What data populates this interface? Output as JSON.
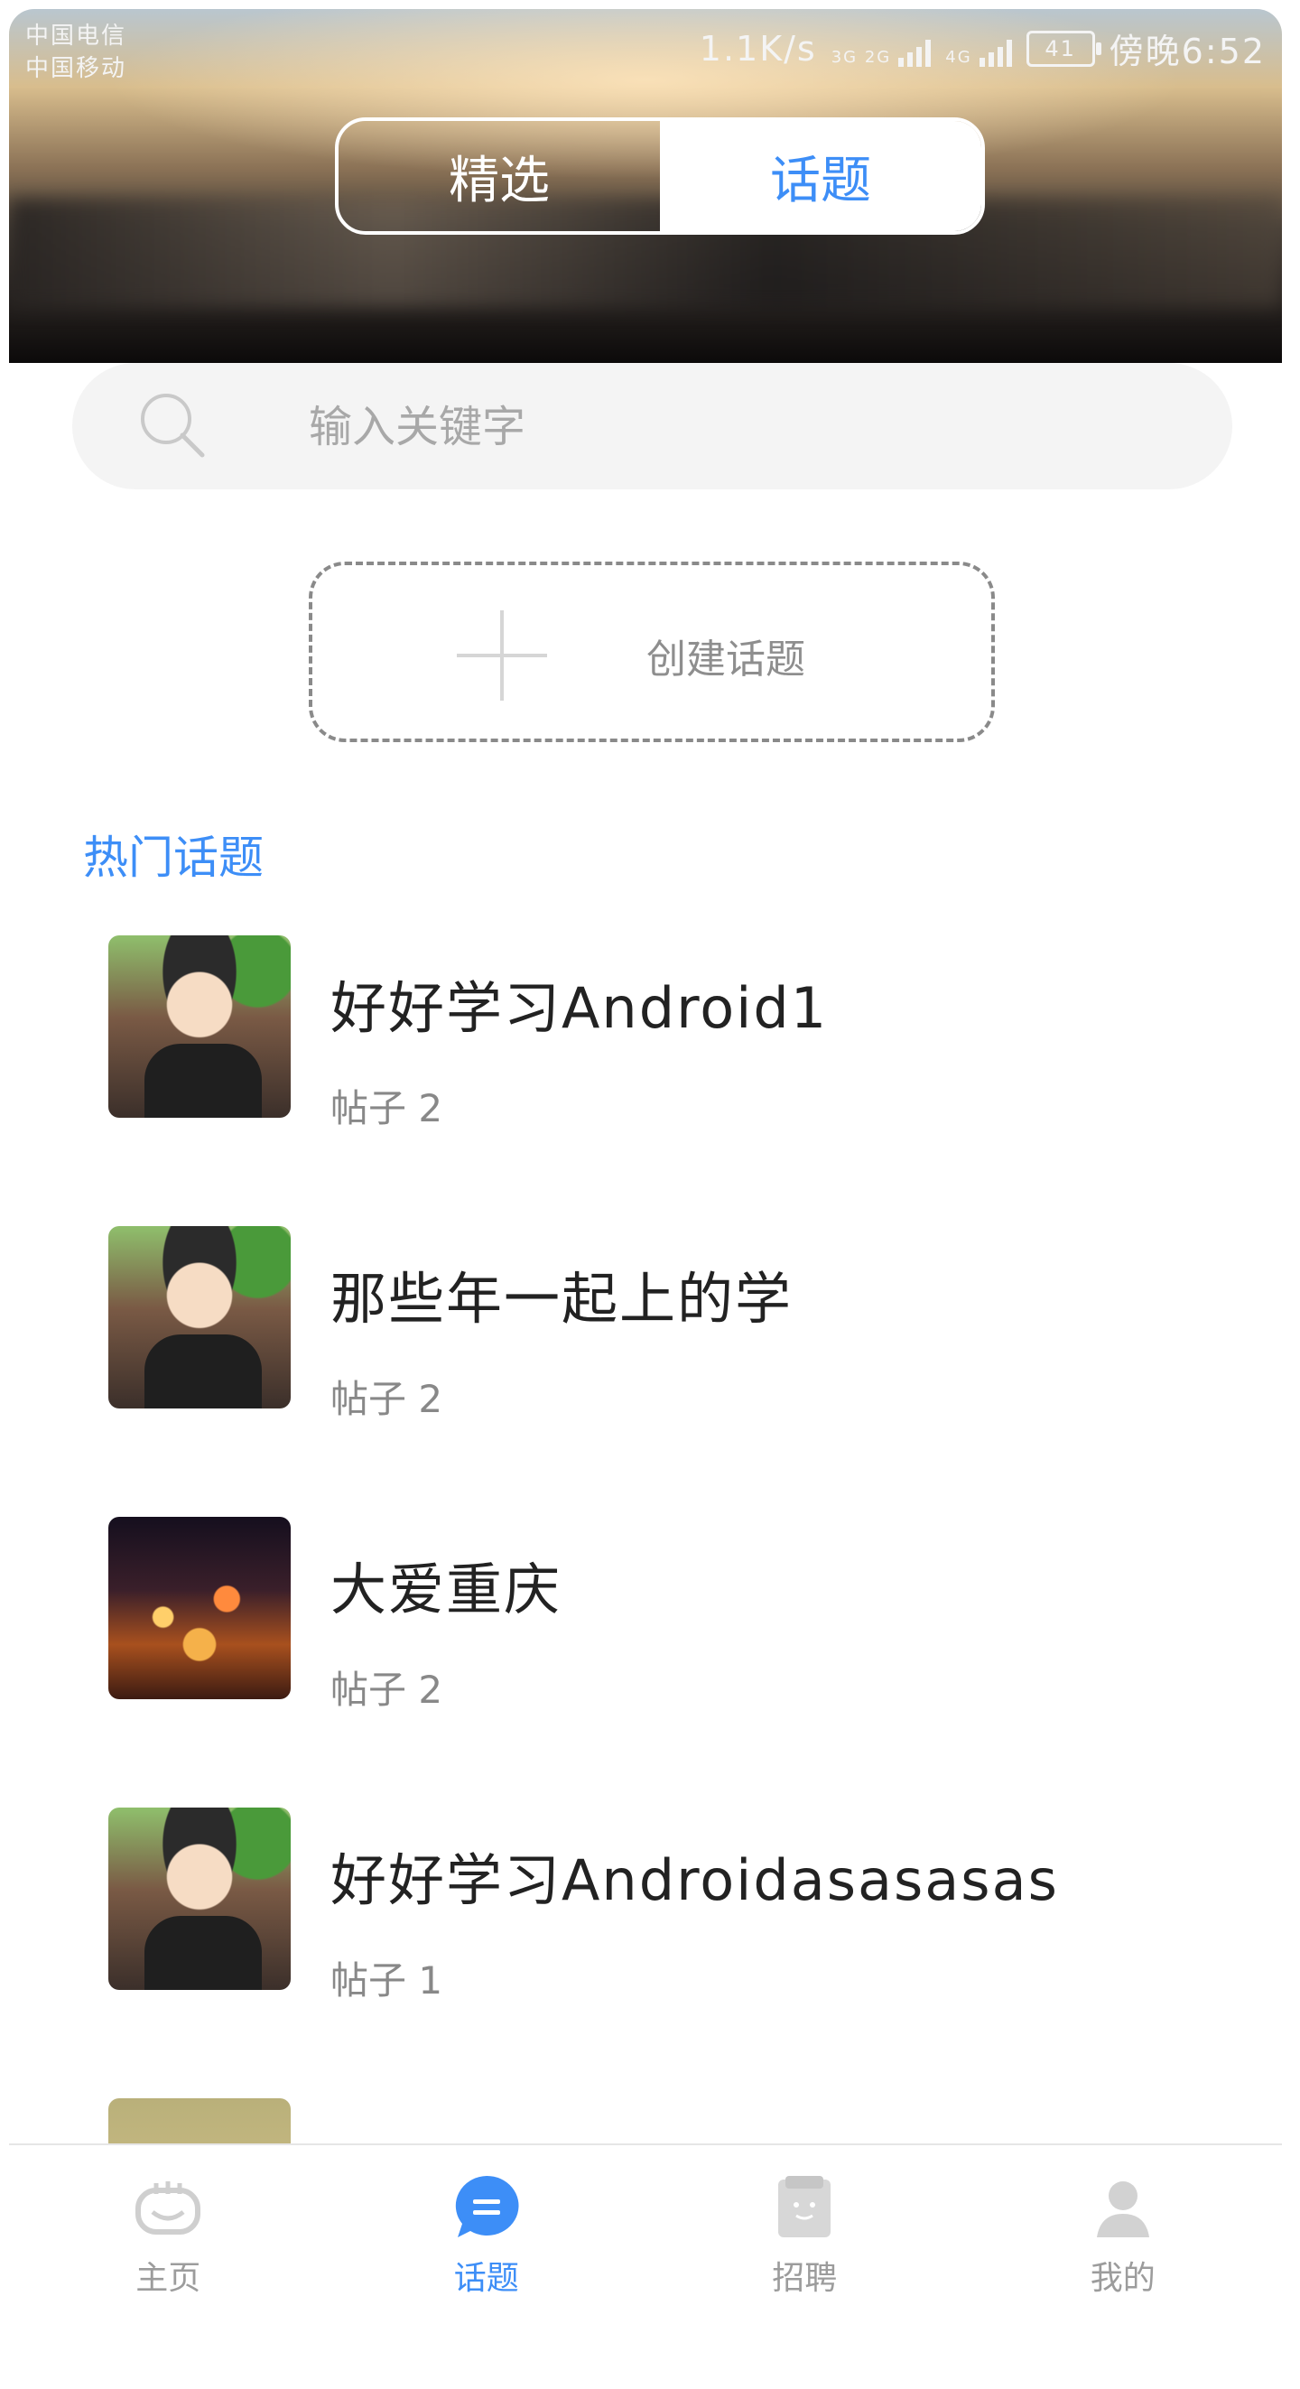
{
  "status_bar": {
    "carrier1": "中国电信",
    "carrier2": "中国移动",
    "speed": "1.1K/s",
    "net1": "3G 2G",
    "net2": "4G",
    "battery": "41",
    "time": "傍晚6:52"
  },
  "segment": {
    "left_label": "精选",
    "right_label": "话题",
    "selected": "话题"
  },
  "search": {
    "placeholder": "输入关键字",
    "value": ""
  },
  "create_topic": {
    "label": "创建话题"
  },
  "hot_topics": {
    "title": "热门话题",
    "items": [
      {
        "name": "好好学习Android1",
        "posts": "帖子 2",
        "thumb": "anime-avatar"
      },
      {
        "name": "那些年一起上的学",
        "posts": "帖子 2",
        "thumb": "anime-avatar"
      },
      {
        "name": "大爱重庆",
        "posts": "帖子 2",
        "thumb": "city-night"
      },
      {
        "name": "好好学习Androidasasasas",
        "posts": "帖子 1",
        "thumb": "anime-avatar"
      }
    ]
  },
  "bottom_nav": {
    "items": [
      {
        "label": "主页",
        "icon": "home-icon"
      },
      {
        "label": "话题",
        "icon": "topic-chat-icon"
      },
      {
        "label": "招聘",
        "icon": "recruit-icon"
      },
      {
        "label": "我的",
        "icon": "profile-icon"
      }
    ],
    "active_index": 1,
    "active_color": "#3d8ef7",
    "inactive_color": "#9c9c9c"
  }
}
